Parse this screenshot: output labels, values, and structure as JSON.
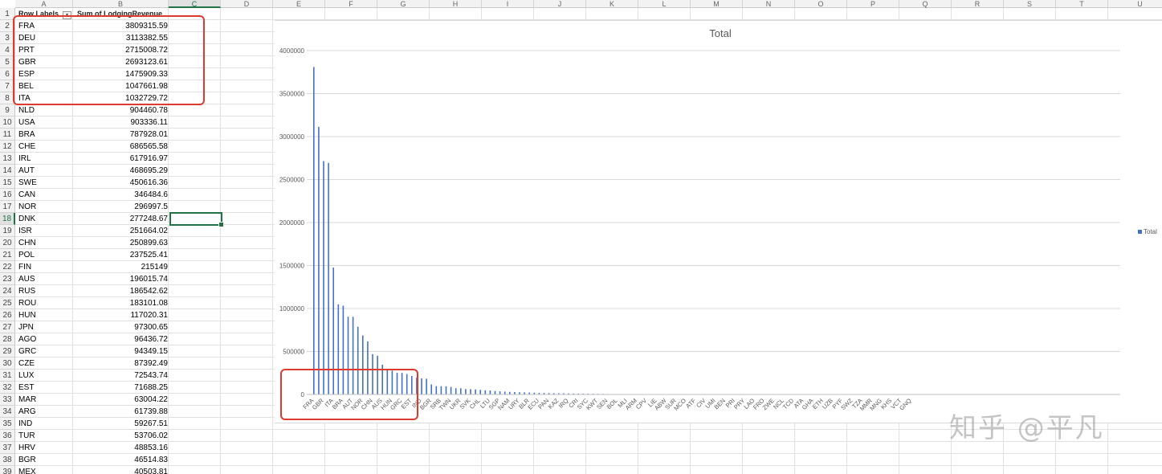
{
  "sheet": {
    "columns": [
      "A",
      "B",
      "C",
      "D",
      "E",
      "F",
      "G",
      "H",
      "I",
      "J",
      "K",
      "L",
      "M",
      "N",
      "O",
      "P",
      "Q",
      "R",
      "S",
      "T",
      "U"
    ],
    "active_column": "C",
    "active_row": 18,
    "header": {
      "row_labels": "Row Labels",
      "sum_label": "Sum of LodgingRevenue"
    },
    "rows": [
      {
        "n": 2,
        "c": "FRA",
        "v": "3809315.59"
      },
      {
        "n": 3,
        "c": "DEU",
        "v": "3113382.55"
      },
      {
        "n": 4,
        "c": "PRT",
        "v": "2715008.72"
      },
      {
        "n": 5,
        "c": "GBR",
        "v": "2693123.61"
      },
      {
        "n": 6,
        "c": "ESP",
        "v": "1475909.33"
      },
      {
        "n": 7,
        "c": "BEL",
        "v": "1047661.98"
      },
      {
        "n": 8,
        "c": "ITA",
        "v": "1032729.72"
      },
      {
        "n": 9,
        "c": "NLD",
        "v": "904460.78"
      },
      {
        "n": 10,
        "c": "USA",
        "v": "903336.11"
      },
      {
        "n": 11,
        "c": "BRA",
        "v": "787928.01"
      },
      {
        "n": 12,
        "c": "CHE",
        "v": "686565.58"
      },
      {
        "n": 13,
        "c": "IRL",
        "v": "617916.97"
      },
      {
        "n": 14,
        "c": "AUT",
        "v": "468695.29"
      },
      {
        "n": 15,
        "c": "SWE",
        "v": "450616.36"
      },
      {
        "n": 16,
        "c": "CAN",
        "v": "346484.6"
      },
      {
        "n": 17,
        "c": "NOR",
        "v": "296997.5"
      },
      {
        "n": 18,
        "c": "DNK",
        "v": "277248.67"
      },
      {
        "n": 19,
        "c": "ISR",
        "v": "251664.02"
      },
      {
        "n": 20,
        "c": "CHN",
        "v": "250899.63"
      },
      {
        "n": 21,
        "c": "POL",
        "v": "237525.41"
      },
      {
        "n": 22,
        "c": "FIN",
        "v": "215149"
      },
      {
        "n": 23,
        "c": "AUS",
        "v": "196015.74"
      },
      {
        "n": 24,
        "c": "RUS",
        "v": "186542.62"
      },
      {
        "n": 25,
        "c": "ROU",
        "v": "183101.08"
      },
      {
        "n": 26,
        "c": "HUN",
        "v": "117020.31"
      },
      {
        "n": 27,
        "c": "JPN",
        "v": "97300.65"
      },
      {
        "n": 28,
        "c": "AGO",
        "v": "96436.72"
      },
      {
        "n": 29,
        "c": "GRC",
        "v": "94349.15"
      },
      {
        "n": 30,
        "c": "CZE",
        "v": "87392.49"
      },
      {
        "n": 31,
        "c": "LUX",
        "v": "72543.74"
      },
      {
        "n": 32,
        "c": "EST",
        "v": "71688.25"
      },
      {
        "n": 33,
        "c": "MAR",
        "v": "63004.22"
      },
      {
        "n": 34,
        "c": "ARG",
        "v": "61739.88"
      },
      {
        "n": 35,
        "c": "IND",
        "v": "59267.51"
      },
      {
        "n": 36,
        "c": "TUR",
        "v": "53706.02"
      },
      {
        "n": 37,
        "c": "HRV",
        "v": "48853.16"
      },
      {
        "n": 38,
        "c": "BGR",
        "v": "46514.83"
      },
      {
        "n": 39,
        "c": "MEX",
        "v": "40503.81"
      }
    ]
  },
  "chart": {
    "series_color": "#4472c4",
    "highlight_color": "#e03a2e"
  },
  "chart_data": {
    "type": "bar",
    "title": "Total",
    "legend": [
      "Total"
    ],
    "legend_position": "right",
    "ylim": [
      0,
      4000000
    ],
    "yticks": [
      "0",
      "500000",
      "1000000",
      "1500000",
      "2000000",
      "2500000",
      "3000000",
      "3500000",
      "4000000"
    ],
    "xtick_labels": [
      "FRA",
      "GBR",
      "ITA",
      "BRA",
      "AUT",
      "NOR",
      "CHN",
      "AUS",
      "HUN",
      "GRC",
      "EST",
      "IND",
      "BGR",
      "SRB",
      "TWN",
      "UKR",
      "SVK",
      "CHL",
      "LTU",
      "SGP",
      "NAM",
      "URY",
      "BLR",
      "ECU",
      "PAN",
      "KAZ",
      "IRQ",
      "CRI",
      "SYC",
      "KWT",
      "SEN",
      "BOL",
      "MLI",
      "ARM",
      "CPV",
      "LIE",
      "ABW",
      "SUR",
      "MCO",
      "ATF",
      "CIV",
      "UMI",
      "BEN",
      "PRI",
      "PRY",
      "LAO",
      "FRO",
      "ZWE",
      "NCL",
      "TCD",
      "ATA",
      "GHA",
      "ETH",
      "UZB",
      "PYF",
      "SWZ",
      "TZA",
      "MMR",
      "MNG",
      "KHS",
      "VCT",
      "GNQ"
    ],
    "values": [
      3809315.59,
      3113382.55,
      2715008.72,
      2693123.61,
      1475909.33,
      1047661.98,
      1032729.72,
      904460.78,
      903336.11,
      787928.01,
      686565.58,
      617916.97,
      468695.29,
      450616.36,
      346484.6,
      296997.5,
      277248.67,
      251664.02,
      250899.63,
      237525.41,
      215149,
      196015.74,
      186542.62,
      183101.08,
      117020.31,
      97300.65,
      96436.72,
      94349.15,
      87392.49,
      72543.74,
      71688.25,
      63004.22,
      61739.88,
      59267.51,
      53706.02,
      48853.16,
      46514.83,
      40503.81,
      36000,
      33000,
      30000,
      28000,
      26000,
      24000,
      22000,
      20000,
      18500,
      17000,
      16000,
      15000,
      14000,
      13000,
      12000,
      11000,
      10000,
      9200,
      8500,
      7800,
      7200,
      6600,
      6000,
      5500,
      5000,
      4500,
      4000,
      3600,
      3200,
      2900,
      2600,
      2300,
      2000,
      1800,
      1600,
      1400,
      1200,
      1050,
      900,
      780,
      660,
      560,
      470,
      400,
      330,
      270,
      220,
      180,
      140,
      110,
      85,
      65,
      50,
      38,
      28,
      20,
      14,
      10,
      7,
      5,
      3,
      2,
      1,
      1,
      0,
      0
    ]
  },
  "watermark": "知乎 @平凡"
}
